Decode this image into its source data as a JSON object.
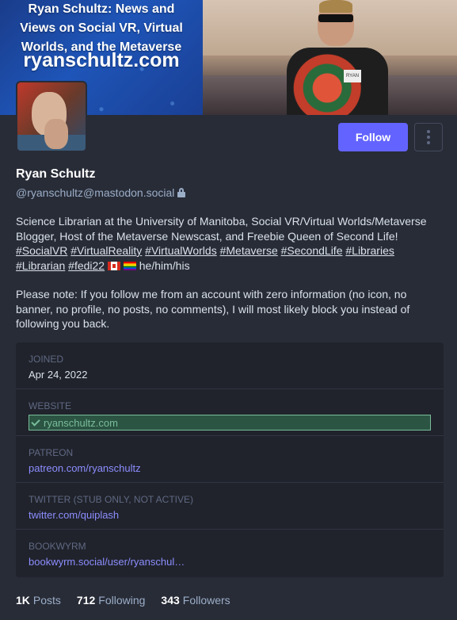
{
  "banner": {
    "title_line1": "Ryan Schultz: News and",
    "title_line2": "Views on Social VR, Virtual",
    "title_line3": "Worlds, and the Metaverse",
    "url": "ryanschultz.com",
    "badge_text": "RYAN"
  },
  "profile": {
    "display_name": "Ryan Schultz",
    "handle": "@ryanschultz@mastodon.social",
    "follow_label": "Follow",
    "bio": {
      "line1": "Science Librarian at the University of Manitoba, Social VR/Virtual Worlds/Metaverse Blogger, Host of the Metaverse Newscast, and Freebie Queen of Second Life!",
      "hashtags": [
        "#SocialVR",
        "#VirtualReality",
        "#VirtualWorlds",
        "#Metaverse",
        "#SecondLife",
        "#Libraries",
        "#Librarian",
        "#fedi22"
      ],
      "pronouns": "he/him/his",
      "note": "Please note: If you follow me from an account with zero information (no icon, no banner, no profile, no posts, no comments), I will most likely block you instead of following you back."
    }
  },
  "fields": [
    {
      "label": "Joined",
      "value": "Apr 24, 2022"
    },
    {
      "label": "Website",
      "value": "ryanschultz.com"
    },
    {
      "label": "Patreon",
      "value": "patreon.com/ryanschultz"
    },
    {
      "label": "Twitter (stub only, not active)",
      "value": "twitter.com/quiplash"
    },
    {
      "label": "BookWyrm",
      "value": "bookwyrm.social/user/ryanschul…"
    }
  ],
  "counts": {
    "posts_value": "1K",
    "posts_label": "Posts",
    "following_value": "712",
    "following_label": "Following",
    "followers_value": "343",
    "followers_label": "Followers"
  },
  "icons": {
    "lock": "lock-icon",
    "check": "check-icon",
    "more": "kebab-menu-icon"
  },
  "colors": {
    "background": "#282c37",
    "accent": "#6364ff",
    "verified": "#79bd9a",
    "link": "#8c8dff"
  }
}
